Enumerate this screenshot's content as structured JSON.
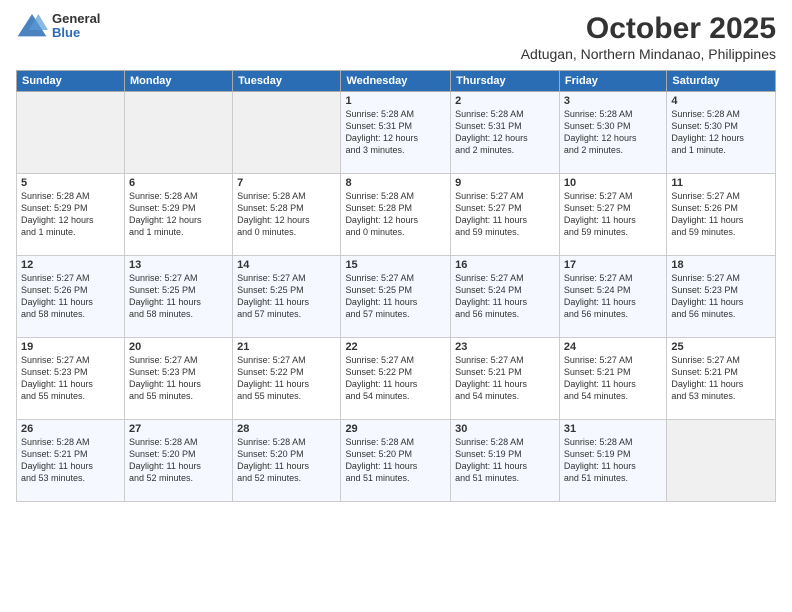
{
  "header": {
    "logo_general": "General",
    "logo_blue": "Blue",
    "month_title": "October 2025",
    "location": "Adtugan, Northern Mindanao, Philippines"
  },
  "days_of_week": [
    "Sunday",
    "Monday",
    "Tuesday",
    "Wednesday",
    "Thursday",
    "Friday",
    "Saturday"
  ],
  "weeks": [
    [
      {
        "day": "",
        "text": ""
      },
      {
        "day": "",
        "text": ""
      },
      {
        "day": "",
        "text": ""
      },
      {
        "day": "1",
        "text": "Sunrise: 5:28 AM\nSunset: 5:31 PM\nDaylight: 12 hours\nand 3 minutes."
      },
      {
        "day": "2",
        "text": "Sunrise: 5:28 AM\nSunset: 5:31 PM\nDaylight: 12 hours\nand 2 minutes."
      },
      {
        "day": "3",
        "text": "Sunrise: 5:28 AM\nSunset: 5:30 PM\nDaylight: 12 hours\nand 2 minutes."
      },
      {
        "day": "4",
        "text": "Sunrise: 5:28 AM\nSunset: 5:30 PM\nDaylight: 12 hours\nand 1 minute."
      }
    ],
    [
      {
        "day": "5",
        "text": "Sunrise: 5:28 AM\nSunset: 5:29 PM\nDaylight: 12 hours\nand 1 minute."
      },
      {
        "day": "6",
        "text": "Sunrise: 5:28 AM\nSunset: 5:29 PM\nDaylight: 12 hours\nand 1 minute."
      },
      {
        "day": "7",
        "text": "Sunrise: 5:28 AM\nSunset: 5:28 PM\nDaylight: 12 hours\nand 0 minutes."
      },
      {
        "day": "8",
        "text": "Sunrise: 5:28 AM\nSunset: 5:28 PM\nDaylight: 12 hours\nand 0 minutes."
      },
      {
        "day": "9",
        "text": "Sunrise: 5:27 AM\nSunset: 5:27 PM\nDaylight: 11 hours\nand 59 minutes."
      },
      {
        "day": "10",
        "text": "Sunrise: 5:27 AM\nSunset: 5:27 PM\nDaylight: 11 hours\nand 59 minutes."
      },
      {
        "day": "11",
        "text": "Sunrise: 5:27 AM\nSunset: 5:26 PM\nDaylight: 11 hours\nand 59 minutes."
      }
    ],
    [
      {
        "day": "12",
        "text": "Sunrise: 5:27 AM\nSunset: 5:26 PM\nDaylight: 11 hours\nand 58 minutes."
      },
      {
        "day": "13",
        "text": "Sunrise: 5:27 AM\nSunset: 5:25 PM\nDaylight: 11 hours\nand 58 minutes."
      },
      {
        "day": "14",
        "text": "Sunrise: 5:27 AM\nSunset: 5:25 PM\nDaylight: 11 hours\nand 57 minutes."
      },
      {
        "day": "15",
        "text": "Sunrise: 5:27 AM\nSunset: 5:25 PM\nDaylight: 11 hours\nand 57 minutes."
      },
      {
        "day": "16",
        "text": "Sunrise: 5:27 AM\nSunset: 5:24 PM\nDaylight: 11 hours\nand 56 minutes."
      },
      {
        "day": "17",
        "text": "Sunrise: 5:27 AM\nSunset: 5:24 PM\nDaylight: 11 hours\nand 56 minutes."
      },
      {
        "day": "18",
        "text": "Sunrise: 5:27 AM\nSunset: 5:23 PM\nDaylight: 11 hours\nand 56 minutes."
      }
    ],
    [
      {
        "day": "19",
        "text": "Sunrise: 5:27 AM\nSunset: 5:23 PM\nDaylight: 11 hours\nand 55 minutes."
      },
      {
        "day": "20",
        "text": "Sunrise: 5:27 AM\nSunset: 5:23 PM\nDaylight: 11 hours\nand 55 minutes."
      },
      {
        "day": "21",
        "text": "Sunrise: 5:27 AM\nSunset: 5:22 PM\nDaylight: 11 hours\nand 55 minutes."
      },
      {
        "day": "22",
        "text": "Sunrise: 5:27 AM\nSunset: 5:22 PM\nDaylight: 11 hours\nand 54 minutes."
      },
      {
        "day": "23",
        "text": "Sunrise: 5:27 AM\nSunset: 5:21 PM\nDaylight: 11 hours\nand 54 minutes."
      },
      {
        "day": "24",
        "text": "Sunrise: 5:27 AM\nSunset: 5:21 PM\nDaylight: 11 hours\nand 54 minutes."
      },
      {
        "day": "25",
        "text": "Sunrise: 5:27 AM\nSunset: 5:21 PM\nDaylight: 11 hours\nand 53 minutes."
      }
    ],
    [
      {
        "day": "26",
        "text": "Sunrise: 5:28 AM\nSunset: 5:21 PM\nDaylight: 11 hours\nand 53 minutes."
      },
      {
        "day": "27",
        "text": "Sunrise: 5:28 AM\nSunset: 5:20 PM\nDaylight: 11 hours\nand 52 minutes."
      },
      {
        "day": "28",
        "text": "Sunrise: 5:28 AM\nSunset: 5:20 PM\nDaylight: 11 hours\nand 52 minutes."
      },
      {
        "day": "29",
        "text": "Sunrise: 5:28 AM\nSunset: 5:20 PM\nDaylight: 11 hours\nand 51 minutes."
      },
      {
        "day": "30",
        "text": "Sunrise: 5:28 AM\nSunset: 5:19 PM\nDaylight: 11 hours\nand 51 minutes."
      },
      {
        "day": "31",
        "text": "Sunrise: 5:28 AM\nSunset: 5:19 PM\nDaylight: 11 hours\nand 51 minutes."
      },
      {
        "day": "",
        "text": ""
      }
    ]
  ]
}
